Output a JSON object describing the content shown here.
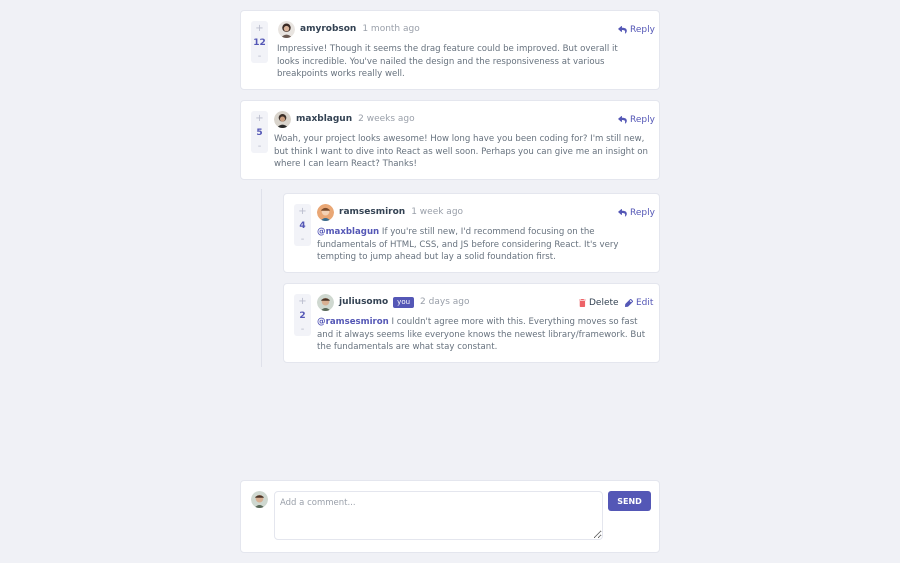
{
  "labels": {
    "reply": "Reply",
    "delete": "Delete",
    "edit": "Edit",
    "you_badge": "you",
    "upvote": "+",
    "downvote": "-"
  },
  "comments": [
    {
      "username": "amyrobson",
      "time": "1 month ago",
      "score": "12",
      "content": "Impressive! Though it seems the drag feature could be improved. But overall it looks incredible. You've nailed the design and the responsiveness at various breakpoints works really well."
    },
    {
      "username": "maxblagun",
      "time": "2 weeks ago",
      "score": "5",
      "content": "Woah, your project looks awesome! How long have you been coding for? I'm still new, but think I want to dive into React as well soon. Perhaps you can give me an insight on where I can learn React? Thanks!"
    }
  ],
  "replies": [
    {
      "username": "ramsesmiron",
      "time": "1 week ago",
      "score": "4",
      "mention": "@maxblagun",
      "content": " If you're still new, I'd recommend focusing on the fundamentals of HTML, CSS, and JS before considering React. It's very tempting to jump ahead but lay a solid foundation first."
    },
    {
      "username": "juliusomo",
      "time": "2 days ago",
      "score": "2",
      "mention": "@ramsesmiron",
      "content": " I couldn't agree more with this. Everything moves so fast and it always seems like everyone knows the newest library/framework. But the fundamentals are what stay constant."
    }
  ],
  "composer": {
    "placeholder": "Add a comment...",
    "send_label": "SEND"
  },
  "colors": {
    "primary": "#5457b6",
    "background": "#f0f1f6",
    "heading": "#334253",
    "text": "#67727e",
    "delete": "#ed6368"
  }
}
